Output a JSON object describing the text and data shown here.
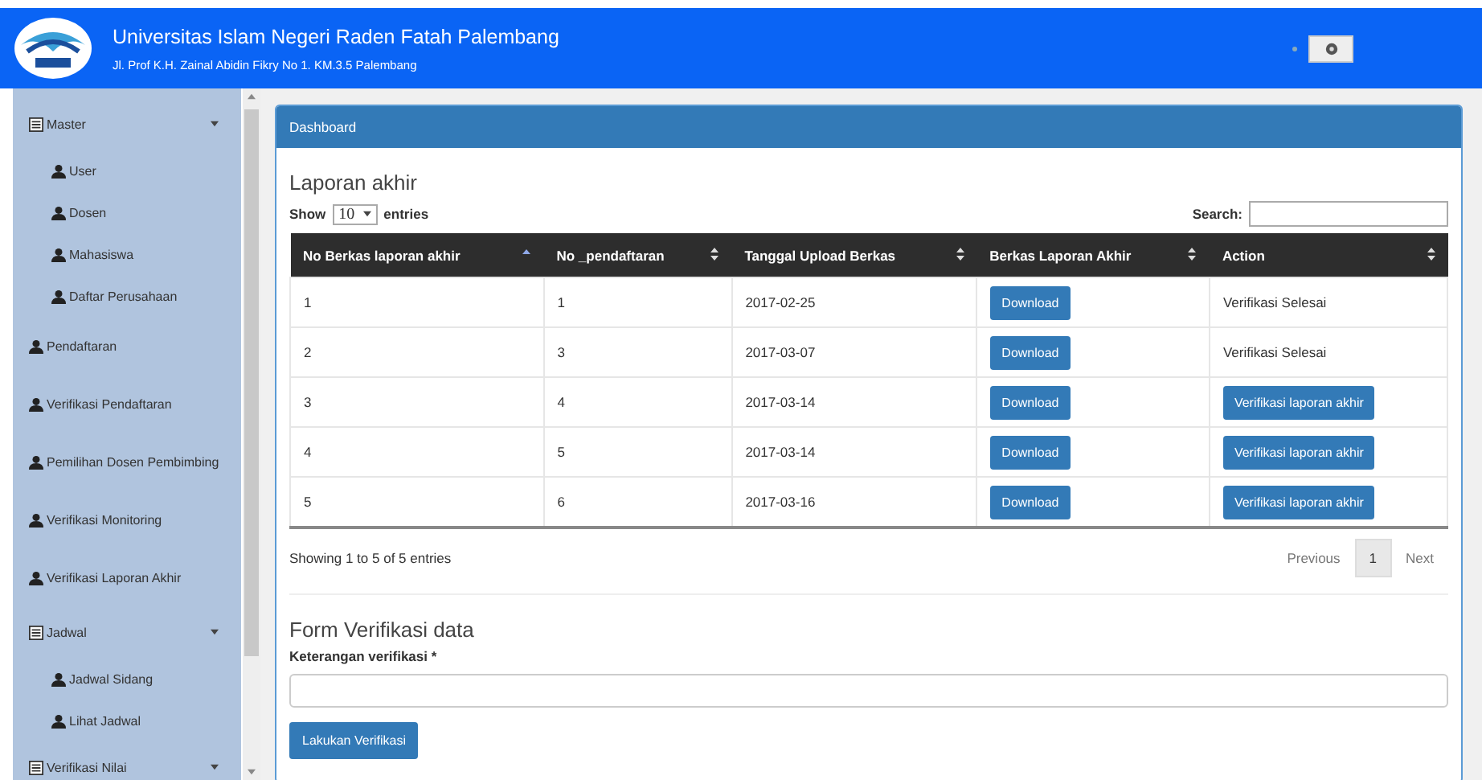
{
  "header": {
    "title": "Universitas Islam Negeri Raden Fatah Palembang",
    "subtitle": "Jl. Prof K.H. Zainal Abidin Fikry No 1. KM.3.5 Palembang"
  },
  "sidebar": {
    "items": [
      {
        "label": "Master",
        "kind": "group",
        "children": [
          {
            "label": "User",
            "kind": "link"
          },
          {
            "label": "Dosen",
            "kind": "link"
          },
          {
            "label": "Mahasiswa",
            "kind": "link"
          },
          {
            "label": "Daftar Perusahaan",
            "kind": "link"
          }
        ]
      },
      {
        "label": "Pendaftaran",
        "kind": "link"
      },
      {
        "label": "Verifikasi Pendaftaran",
        "kind": "link"
      },
      {
        "label": "Pemilihan Dosen Pembimbing",
        "kind": "link"
      },
      {
        "label": "Verifikasi Monitoring",
        "kind": "link"
      },
      {
        "label": "Verifikasi Laporan Akhir",
        "kind": "link"
      },
      {
        "label": "Jadwal",
        "kind": "group",
        "children": [
          {
            "label": "Jadwal Sidang",
            "kind": "link"
          },
          {
            "label": "Lihat Jadwal",
            "kind": "link"
          }
        ]
      },
      {
        "label": "Verifikasi Nilai",
        "kind": "group"
      }
    ]
  },
  "panel": {
    "heading": "Dashboard",
    "title": "Laporan akhir",
    "length": {
      "before": "Show",
      "value": "10",
      "after": "entries"
    },
    "search": {
      "label": "Search:"
    },
    "table": {
      "columns": [
        {
          "label": "No Berkas laporan akhir",
          "sorted": true
        },
        {
          "label": "No _pendaftaran",
          "sorted": false
        },
        {
          "label": "Tanggal Upload Berkas",
          "sorted": false
        },
        {
          "label": "Berkas Laporan Akhir",
          "sorted": false
        },
        {
          "label": "Action",
          "sorted": false
        }
      ],
      "rows": [
        {
          "cells": [
            "1",
            "1",
            "2017-02-25"
          ],
          "file_button": "Download",
          "action": {
            "kind": "text",
            "label": "Verifikasi Selesai"
          }
        },
        {
          "cells": [
            "2",
            "3",
            "2017-03-07"
          ],
          "file_button": "Download",
          "action": {
            "kind": "text",
            "label": "Verifikasi Selesai"
          }
        },
        {
          "cells": [
            "3",
            "4",
            "2017-03-14"
          ],
          "file_button": "Download",
          "action": {
            "kind": "button",
            "label": "Verifikasi laporan akhir"
          }
        },
        {
          "cells": [
            "4",
            "5",
            "2017-03-14"
          ],
          "file_button": "Download",
          "action": {
            "kind": "button",
            "label": "Verifikasi laporan akhir"
          }
        },
        {
          "cells": [
            "5",
            "6",
            "2017-03-16"
          ],
          "file_button": "Download",
          "action": {
            "kind": "button",
            "label": "Verifikasi laporan akhir"
          }
        }
      ]
    },
    "info": "Showing 1 to 5 of 5 entries",
    "pagination": [
      {
        "label": "Previous",
        "selected": false
      },
      {
        "label": "1",
        "selected": true
      },
      {
        "label": "Next",
        "selected": false
      }
    ],
    "form": {
      "title": "Form Verifikasi data",
      "field_label": "Keterangan verifikasi *",
      "submit": "Lakukan Verifikasi"
    }
  }
}
